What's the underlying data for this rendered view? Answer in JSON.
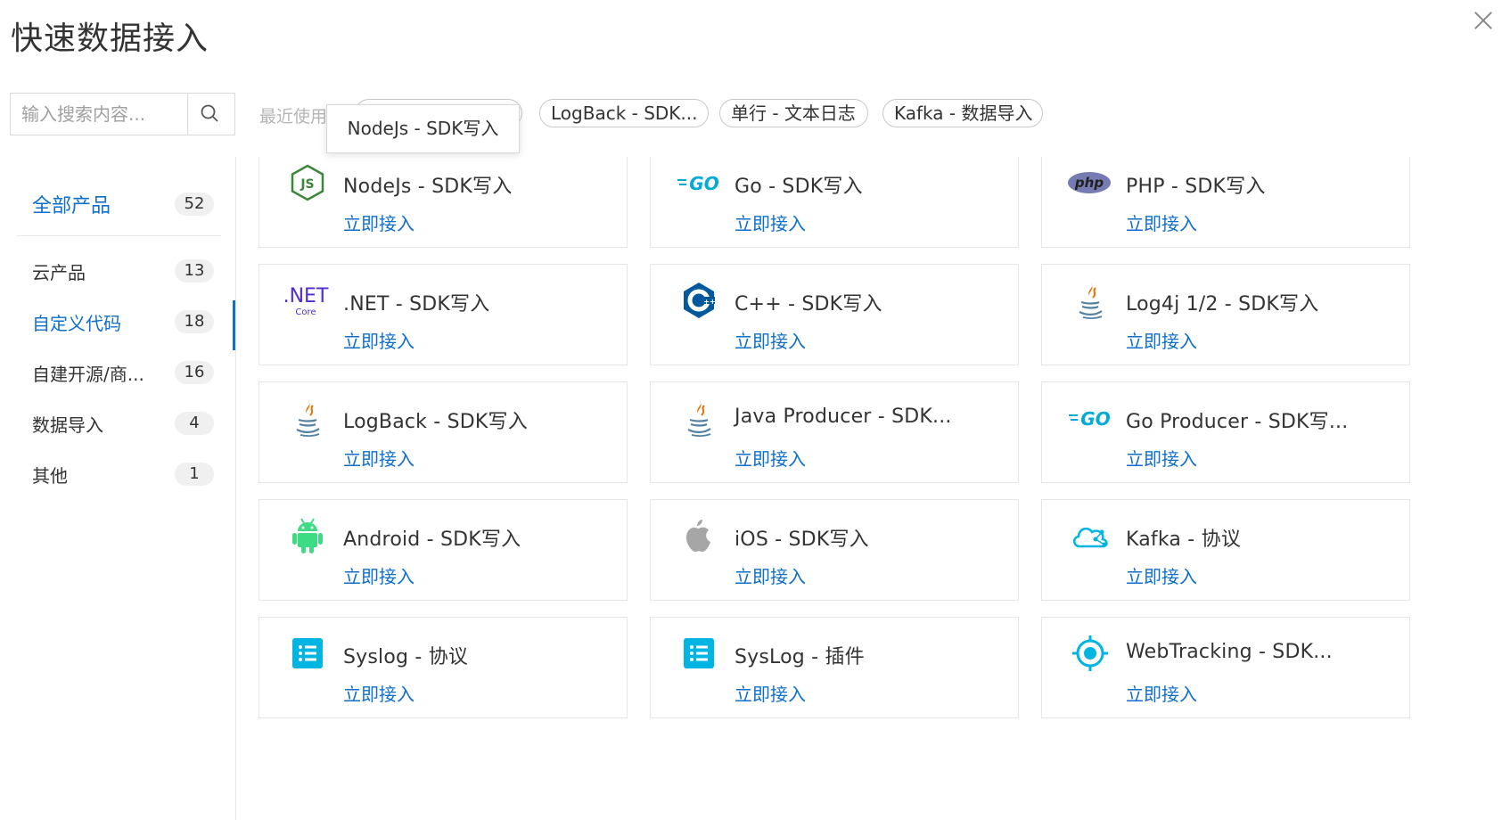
{
  "title": "快速数据接入",
  "search": {
    "placeholder": "输入搜索内容..."
  },
  "recent": {
    "label": "最近使用",
    "chips": [
      "NodeJs - SDK写入",
      "LogBack - SDK...",
      "单行 - 文本日志",
      "Kafka - 数据导入"
    ],
    "tooltip": "NodeJs - SDK写入"
  },
  "sidebar": {
    "all": {
      "label": "全部产品",
      "count": "52"
    },
    "items": [
      {
        "label": "云产品",
        "count": "13"
      },
      {
        "label": "自定义代码",
        "count": "18",
        "active": true
      },
      {
        "label": "自建开源/商...",
        "count": "16"
      },
      {
        "label": "数据导入",
        "count": "4"
      },
      {
        "label": "其他",
        "count": "1"
      }
    ]
  },
  "cards": [
    {
      "name": "NodeJs - SDK写入",
      "link": "立即接入",
      "icon": "nodejs-icon"
    },
    {
      "name": "Go - SDK写入",
      "link": "立即接入",
      "icon": "go-icon"
    },
    {
      "name": "PHP - SDK写入",
      "link": "立即接入",
      "icon": "php-icon"
    },
    {
      "name": ".NET - SDK写入",
      "link": "立即接入",
      "icon": "dotnet-icon"
    },
    {
      "name": "C++ - SDK写入",
      "link": "立即接入",
      "icon": "cpp-icon"
    },
    {
      "name": "Log4j 1/2 - SDK写入",
      "link": "立即接入",
      "icon": "java-icon"
    },
    {
      "name": "LogBack - SDK写入",
      "link": "立即接入",
      "icon": "java-icon"
    },
    {
      "name": "Java Producer - SDK...",
      "link": "立即接入",
      "icon": "java-icon"
    },
    {
      "name": "Go Producer - SDK写...",
      "link": "立即接入",
      "icon": "go-icon"
    },
    {
      "name": "Android - SDK写入",
      "link": "立即接入",
      "icon": "android-icon"
    },
    {
      "name": "iOS - SDK写入",
      "link": "立即接入",
      "icon": "apple-icon"
    },
    {
      "name": "Kafka - 协议",
      "link": "立即接入",
      "icon": "kafka-cloud-icon"
    },
    {
      "name": "Syslog - 协议",
      "link": "立即接入",
      "icon": "list-icon"
    },
    {
      "name": "SysLog - 插件",
      "link": "立即接入",
      "icon": "list-icon"
    },
    {
      "name": "WebTracking - SDK...",
      "link": "立即接入",
      "icon": "target-icon"
    }
  ],
  "icon_text": {
    "go": "GO",
    "php": "php",
    "net": ".NET",
    "core": "Core"
  },
  "colors": {
    "accent": "#0f6fce",
    "node": "#3c873a",
    "go": "#00acd7",
    "php": "#777bb3",
    "dotnet": "#512bd4",
    "cpp": "#00599c",
    "android": "#3ddc84",
    "apple": "#a6a6a6",
    "cyan": "#00b5e2"
  }
}
